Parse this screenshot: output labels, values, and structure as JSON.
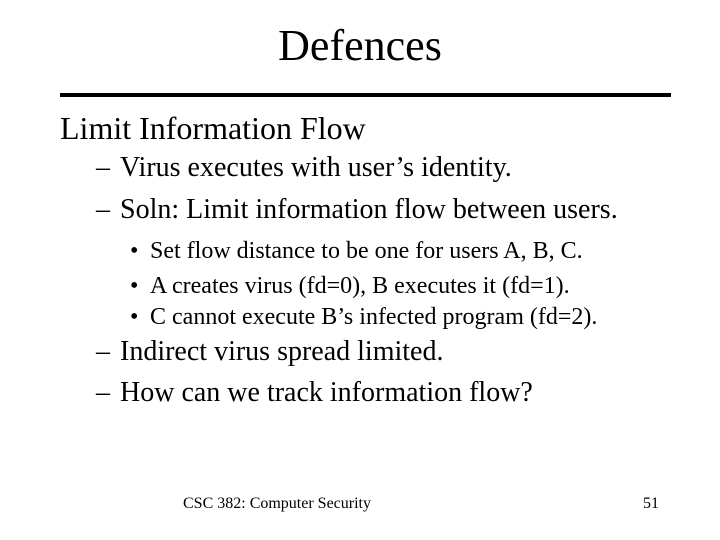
{
  "slide": {
    "title": "Defences",
    "heading": "Limit Information Flow",
    "level2_marker": "–",
    "level3_marker": "•",
    "points_a": [
      "Virus executes with user’s identity.",
      "Soln: Limit information flow between users."
    ],
    "sub_points": [
      "Set flow distance to be one for users A, B, C.",
      "A creates virus (fd=0), B executes it (fd=1).",
      "C cannot execute B’s infected program (fd=2)."
    ],
    "points_b": [
      "Indirect virus spread limited.",
      "How can we track information flow?"
    ]
  },
  "footer": {
    "course": "CSC 382: Computer Security",
    "page_number": "51"
  }
}
